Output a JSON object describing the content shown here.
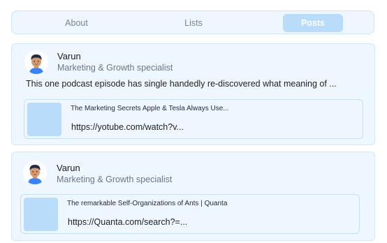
{
  "tabs": {
    "about": "About",
    "lists": "Lists",
    "posts": "Posts"
  },
  "posts": [
    {
      "author": "Varun",
      "role": "Marketing & Growth specialist",
      "text": "This one podcast episode has single handedly re-discovered what meaning of ...",
      "link_title": "The Marketing Secrets Apple & Tesla Always Use...",
      "link_url": "https://yotube.com/watch?v..."
    },
    {
      "author": "Varun",
      "role": "Marketing & Growth specialist",
      "link_title": "The remarkable Self-Organizations of Ants | Quanta",
      "link_url": "https://Quanta.com/search?=..."
    }
  ],
  "colors": {
    "accent": "#b9dcfb",
    "panel": "#eef6ff",
    "border": "#cfe5f8"
  }
}
